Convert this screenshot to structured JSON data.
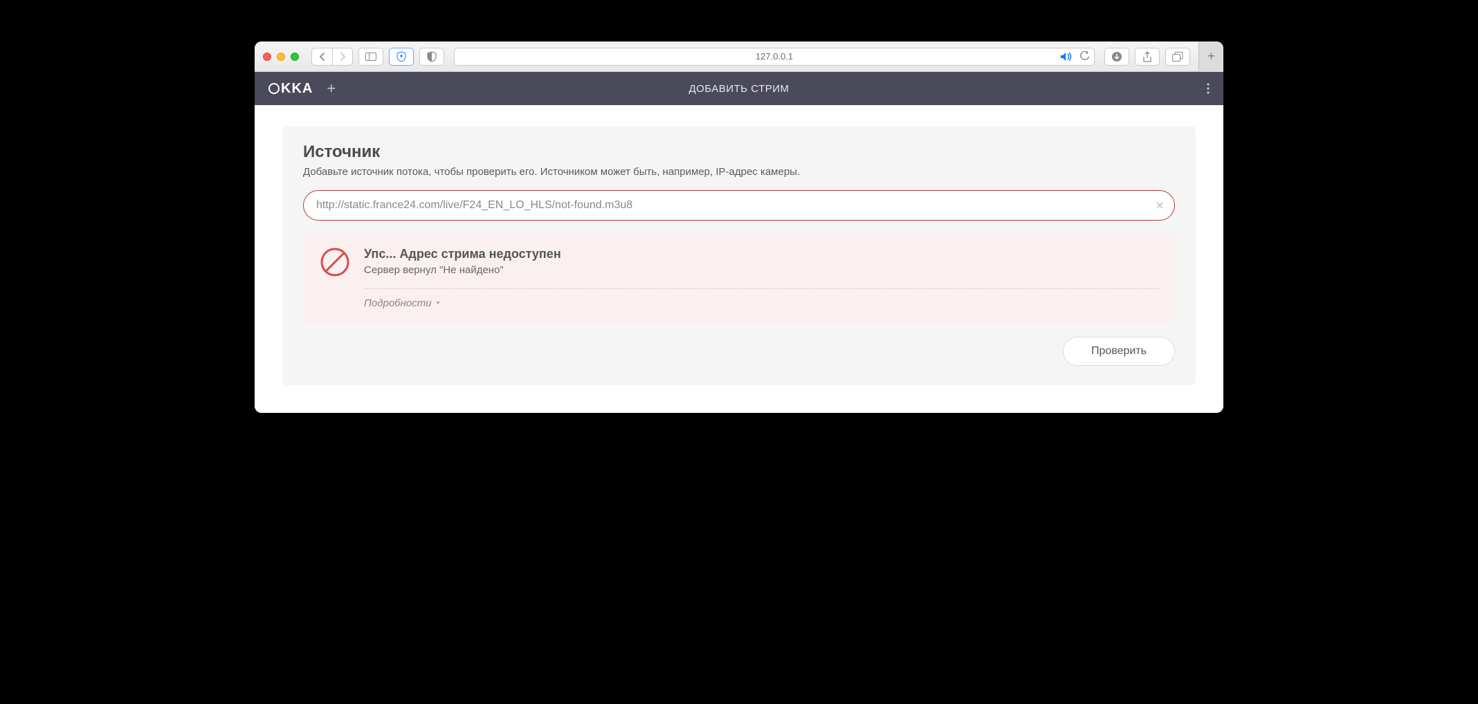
{
  "browser": {
    "address": "127.0.0.1"
  },
  "header": {
    "logo_text": "KKA",
    "title": "ДОБАВИТЬ СТРИМ"
  },
  "source": {
    "title": "Источник",
    "subtitle": "Добавьте источник потока, чтобы проверить его. Источником может быть, например, IP-адрес камеры.",
    "url_value": "http://static.france24.com/live/F24_EN_LO_HLS/not-found.m3u8"
  },
  "error": {
    "title": "Упс... Адрес стрима недоступен",
    "message": "Сервер вернул \"Не найдено\"",
    "details_label": "Подробности"
  },
  "actions": {
    "check_label": "Проверить"
  }
}
